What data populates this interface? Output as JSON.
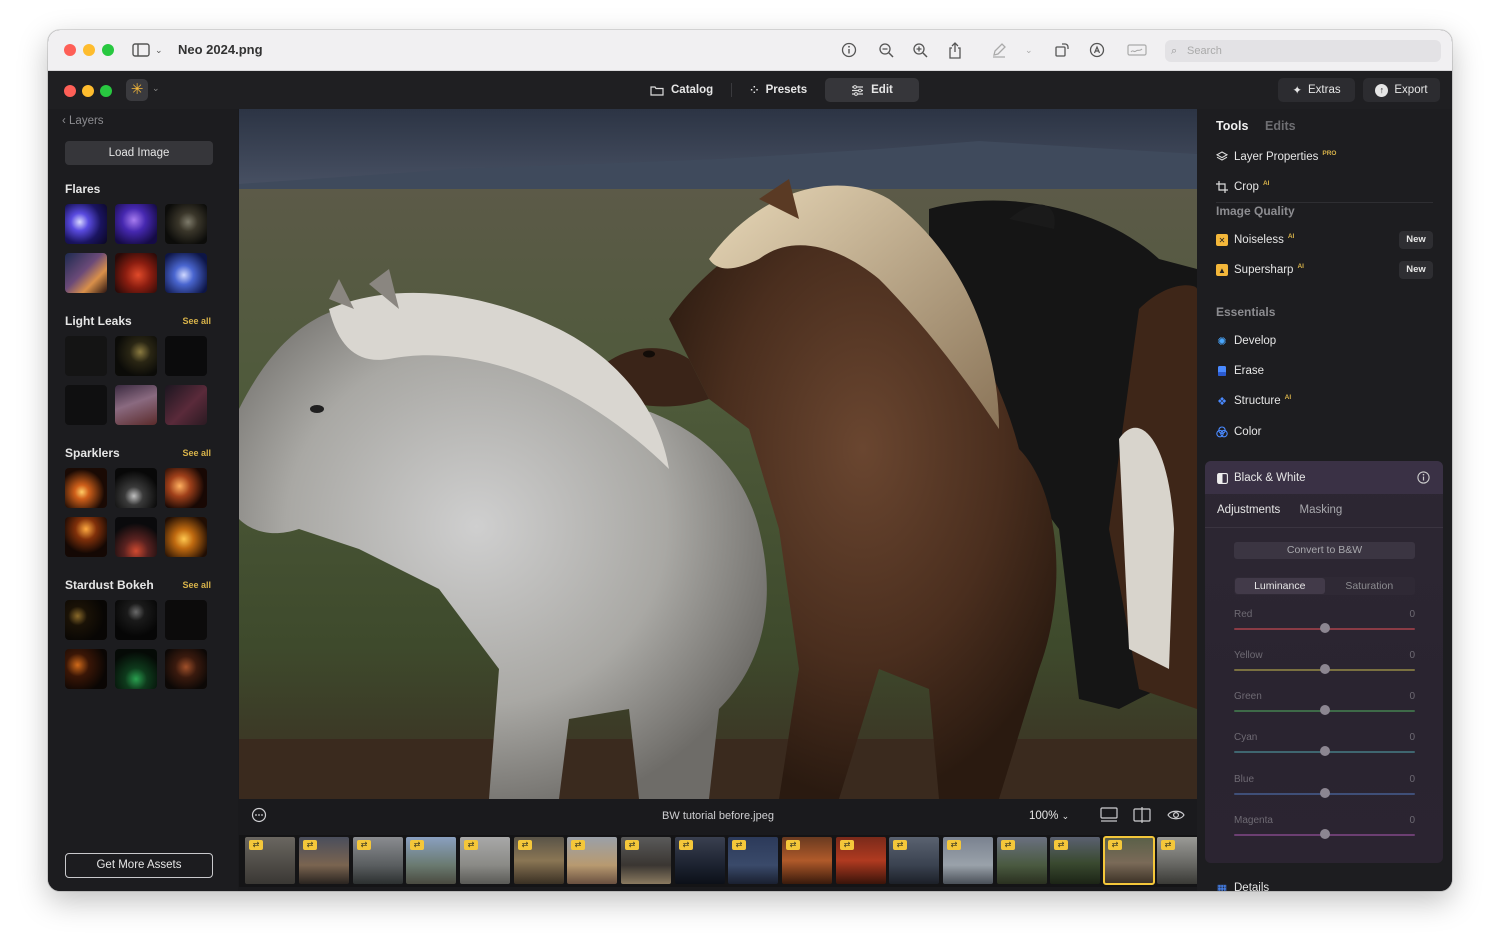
{
  "os_bar": {
    "title": "Neo 2024.png",
    "search_placeholder": "Search"
  },
  "app_bar": {
    "tabs": [
      {
        "label": "Catalog"
      },
      {
        "label": "Presets"
      },
      {
        "label": "Edit"
      }
    ],
    "extras_label": "Extras",
    "export_label": "Export"
  },
  "left_panel": {
    "back_label": "Layers",
    "load_label": "Load Image",
    "sections": [
      {
        "title": "Flares",
        "see_all": ""
      },
      {
        "title": "Light Leaks",
        "see_all": "See all"
      },
      {
        "title": "Sparklers",
        "see_all": "See all"
      },
      {
        "title": "Stardust Bokeh",
        "see_all": "See all"
      }
    ],
    "get_more_label": "Get More Assets"
  },
  "canvas": {
    "filename": "BW tutorial before.jpeg",
    "zoom": "100%"
  },
  "right_panel": {
    "tabs": {
      "tools": "Tools",
      "edits": "Edits"
    },
    "layer_properties": "Layer Properties",
    "layer_properties_badge": "PRO",
    "crop": "Crop",
    "ai_badge": "AI",
    "image_quality": "Image Quality",
    "noiseless": "Noiseless",
    "supersharp": "Supersharp",
    "new_badge": "New",
    "essentials": "Essentials",
    "develop": "Develop",
    "erase": "Erase",
    "structure": "Structure",
    "color": "Color",
    "bw": {
      "title": "Black & White",
      "adjustments": "Adjustments",
      "masking": "Masking",
      "convert": "Convert to B&W",
      "luminance": "Luminance",
      "saturation": "Saturation",
      "sliders": [
        {
          "label": "Red",
          "value": "0",
          "color": "#8a3b45"
        },
        {
          "label": "Yellow",
          "value": "0",
          "color": "#7a7040"
        },
        {
          "label": "Green",
          "value": "0",
          "color": "#3e6a48"
        },
        {
          "label": "Cyan",
          "value": "0",
          "color": "#3f6670"
        },
        {
          "label": "Blue",
          "value": "0",
          "color": "#3f4f78"
        },
        {
          "label": "Magenta",
          "value": "0",
          "color": "#6c3f72"
        }
      ]
    },
    "details_partial": "Details"
  }
}
